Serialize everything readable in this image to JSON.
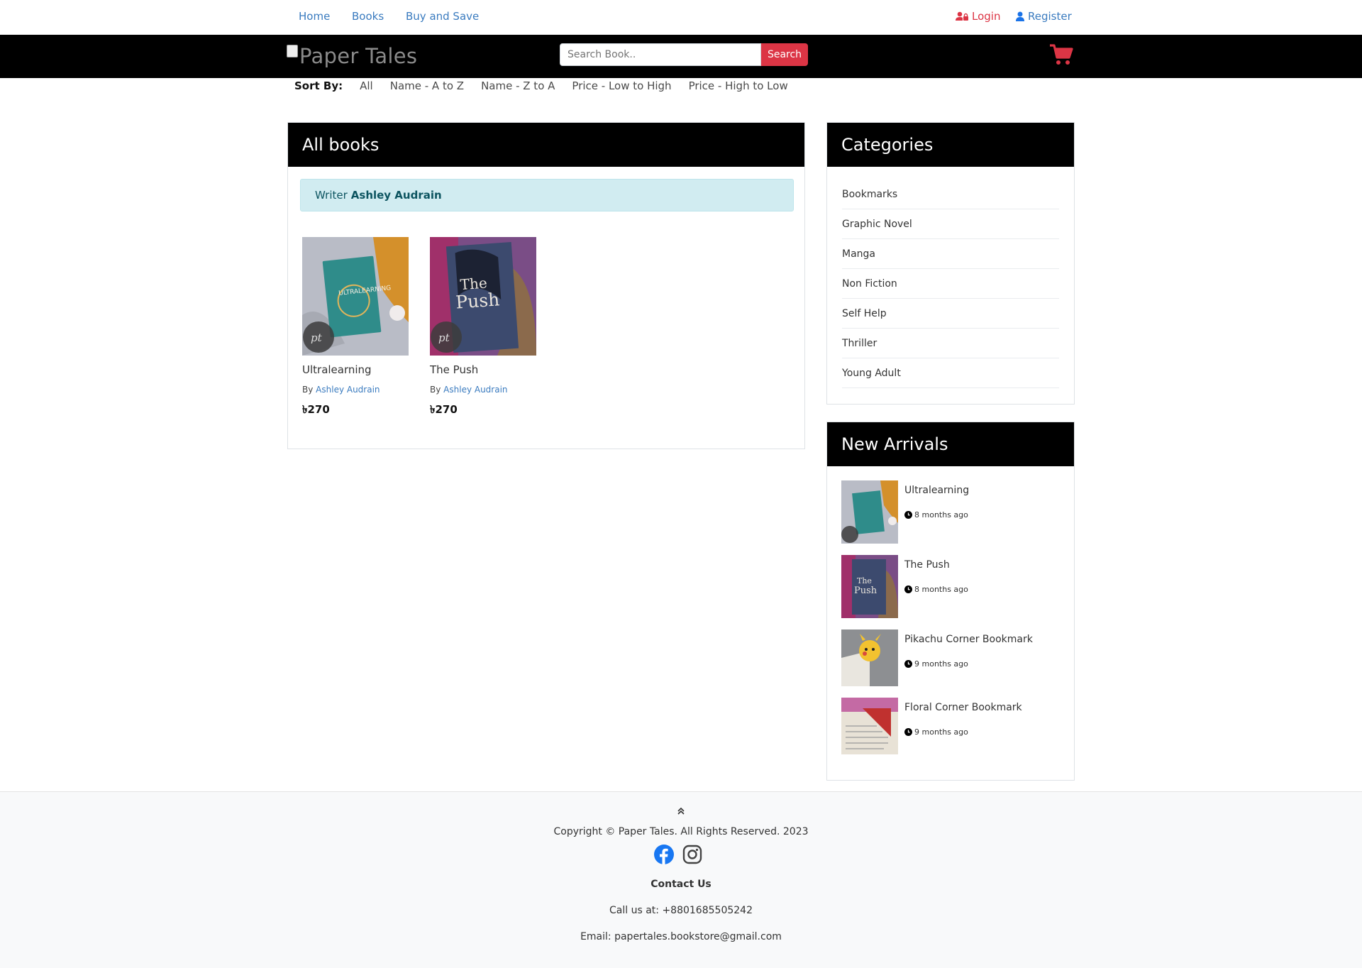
{
  "topnav": {
    "home": "Home",
    "books": "Books",
    "buy_and_save": "Buy and Save",
    "login": "Login",
    "register": "Register"
  },
  "header": {
    "logo_alt": "Paper Tales",
    "search_placeholder": "Search Book..",
    "search_button": "Search",
    "cart_icon": "shopping-cart-icon"
  },
  "sort": {
    "label": "Sort By:",
    "options": [
      "All",
      "Name - A to Z",
      "Name - Z to A",
      "Price - Low to High",
      "Price - High to Low"
    ]
  },
  "main": {
    "title": "All books",
    "writer_prefix": "Writer",
    "writer_name": "Ashley Audrain",
    "books": [
      {
        "title": "Ultralearning",
        "by": "By",
        "author": "Ashley Audrain",
        "price": "৳270"
      },
      {
        "title": "The Push",
        "by": "By",
        "author": "Ashley Audrain",
        "price": "৳270"
      }
    ]
  },
  "categories": {
    "title": "Categories",
    "items": [
      "Bookmarks",
      "Graphic Novel",
      "Manga",
      "Non Fiction",
      "Self Help",
      "Thriller",
      "Young Adult"
    ]
  },
  "new_arrivals": {
    "title": "New Arrivals",
    "items": [
      {
        "title": "Ultralearning",
        "time": "8 months ago"
      },
      {
        "title": "The Push",
        "time": "8 months ago"
      },
      {
        "title": "Pikachu Corner Bookmark",
        "time": "9 months ago"
      },
      {
        "title": "Floral Corner Bookmark",
        "time": "9 months ago"
      }
    ]
  },
  "footer": {
    "copyright": "Copyright © Paper Tales. All Rights Reserved. 2023",
    "contact_title": "Contact Us",
    "phone": "Call us at: +8801685505242",
    "email": "Email: papertales.bookstore@gmail.com"
  },
  "colors": {
    "accent_red": "#dc3545",
    "link_blue": "#3a7bbf",
    "header_black": "#000000",
    "alert_info_bg": "#d1ecf1"
  }
}
